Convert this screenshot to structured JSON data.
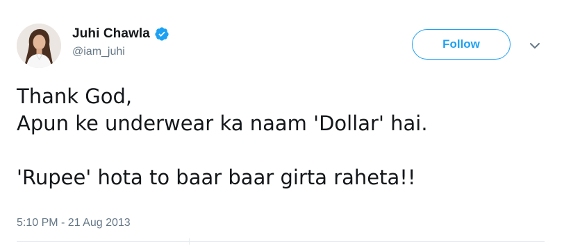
{
  "user": {
    "display_name": "Juhi Chawla",
    "handle": "@iam_juhi",
    "verified": true,
    "avatar_icon": "profile-photo"
  },
  "actions": {
    "follow_label": "Follow",
    "more_icon": "chevron-down-icon"
  },
  "tweet": {
    "lines": [
      "Thank God,",
      "Apun ke underwear ka naam 'Dollar' hai.",
      "",
      "'Rupee' hota to baar baar girta raheta!!"
    ],
    "timestamp": "5:10 PM - 21 Aug 2013"
  },
  "colors": {
    "accent": "#1da1f2",
    "text": "#14171a",
    "secondary_text": "#657786",
    "divider": "#e6ecf0"
  }
}
